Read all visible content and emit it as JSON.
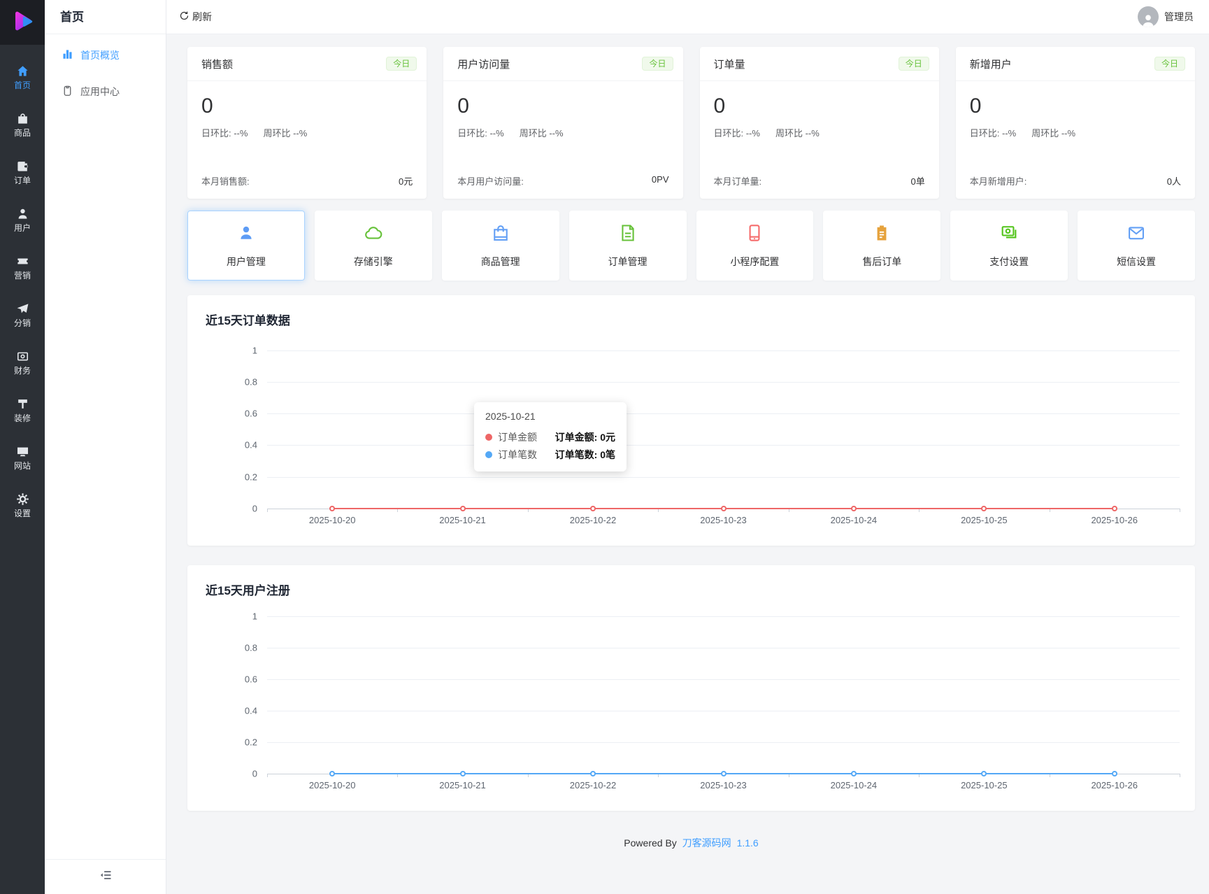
{
  "colors": {
    "accent": "#409eff",
    "badge_green": "#67c23a",
    "badge_green_bg": "#f0f9eb",
    "chart_red": "#ee6666",
    "chart_blue": "#54a8f6",
    "warning_orange": "#e6a23c",
    "danger_red": "#f56c6c",
    "success_green": "#67c23a",
    "rail_bg": "#2c3036"
  },
  "rail": {
    "logo_icon": "play-logo-icon",
    "items": [
      {
        "label": "首页",
        "icon": "home-icon",
        "active": true
      },
      {
        "label": "商品",
        "icon": "goods-bag-icon",
        "active": false
      },
      {
        "label": "订单",
        "icon": "order-wallet-icon",
        "active": false
      },
      {
        "label": "用户",
        "icon": "user-icon",
        "active": false
      },
      {
        "label": "营销",
        "icon": "marketing-ticket-icon",
        "active": false
      },
      {
        "label": "分销",
        "icon": "distribution-plane-icon",
        "active": false
      },
      {
        "label": "财务",
        "icon": "finance-money-icon",
        "active": false
      },
      {
        "label": "装修",
        "icon": "decorate-roller-icon",
        "active": false
      },
      {
        "label": "网站",
        "icon": "website-monitor-icon",
        "active": false
      },
      {
        "label": "设置",
        "icon": "gear-icon",
        "active": false
      }
    ]
  },
  "submenu": {
    "title": "首页",
    "items": [
      {
        "label": "首页概览",
        "icon": "bar-chart-icon",
        "active": true
      },
      {
        "label": "应用中心",
        "icon": "clipboard-icon",
        "active": false
      }
    ],
    "collapse_icon": "menu-fold-icon"
  },
  "topbar": {
    "refresh_label": "刷新",
    "refresh_icon": "refresh-icon",
    "user_label": "管理员",
    "avatar_icon": "person-silhouette-icon"
  },
  "stats": {
    "badge": "今日",
    "cards": [
      {
        "title": "销售额",
        "value": "0",
        "day": "日环比: --%",
        "week": "周环比 --%",
        "month_label": "本月销售额:",
        "month_value": "0元"
      },
      {
        "title": "用户访问量",
        "value": "0",
        "day": "日环比: --%",
        "week": "周环比 --%",
        "month_label": "本月用户访问量:",
        "month_value": "0PV"
      },
      {
        "title": "订单量",
        "value": "0",
        "day": "日环比: --%",
        "week": "周环比 --%",
        "month_label": "本月订单量:",
        "month_value": "0单"
      },
      {
        "title": "新增用户",
        "value": "0",
        "day": "日环比: --%",
        "week": "周环比 --%",
        "month_label": "本月新增用户:",
        "month_value": "0人"
      }
    ]
  },
  "shortcuts": [
    {
      "label": "用户管理",
      "icon": "user-icon",
      "color": "#5d9cf5",
      "highlighted": true
    },
    {
      "label": "存储引擎",
      "icon": "cloud-icon",
      "color": "#67c23a",
      "highlighted": false
    },
    {
      "label": "商品管理",
      "icon": "shopping-bag-icon",
      "color": "#64a0f5",
      "highlighted": false
    },
    {
      "label": "订单管理",
      "icon": "document-icon",
      "color": "#67c23a",
      "highlighted": false
    },
    {
      "label": "小程序配置",
      "icon": "phone-icon",
      "color": "#f56c6c",
      "highlighted": false
    },
    {
      "label": "售后订单",
      "icon": "clipboard-filled-icon",
      "color": "#e6a23c",
      "highlighted": false
    },
    {
      "label": "支付设置",
      "icon": "banknote-icon",
      "color": "#52c41a",
      "highlighted": false
    },
    {
      "label": "短信设置",
      "icon": "envelope-icon",
      "color": "#64a0f5",
      "highlighted": false
    }
  ],
  "chart_data": [
    {
      "type": "line",
      "title": "近15天订单数据",
      "x": [
        "2025-10-20",
        "2025-10-21",
        "2025-10-22",
        "2025-10-23",
        "2025-10-24",
        "2025-10-25",
        "2025-10-26"
      ],
      "series": [
        {
          "name": "订单金额",
          "values": [
            0,
            0,
            0,
            0,
            0,
            0,
            0
          ],
          "unit": "元",
          "color": "#ee6666"
        },
        {
          "name": "订单笔数",
          "values": [
            0,
            0,
            0,
            0,
            0,
            0,
            0
          ],
          "unit": "笔",
          "color": "#54a8f6"
        }
      ],
      "yticks": [
        "1",
        "0.8",
        "0.6",
        "0.4",
        "0.2",
        "0"
      ],
      "ylim": [
        0,
        1
      ],
      "grid": true,
      "legend_position": "none"
    },
    {
      "type": "line",
      "title": "近15天用户注册",
      "x": [
        "2025-10-20",
        "2025-10-21",
        "2025-10-22",
        "2025-10-23",
        "2025-10-24",
        "2025-10-25",
        "2025-10-26"
      ],
      "series": [
        {
          "values": [
            0,
            0,
            0,
            0,
            0,
            0,
            0
          ],
          "color": "#54a8f6"
        }
      ],
      "yticks": [
        "1",
        "0.8",
        "0.6",
        "0.4",
        "0.2",
        "0"
      ],
      "ylim": [
        0,
        1
      ],
      "grid": true,
      "legend_position": "none"
    }
  ],
  "tooltip": {
    "date": "2025-10-21",
    "rows": [
      {
        "name": "订单金额",
        "value": "订单金额: 0元",
        "color": "#ee6666"
      },
      {
        "name": "订单笔数",
        "value": "订单笔数: 0笔",
        "color": "#54a8f6"
      }
    ]
  },
  "footer": {
    "powered_by": "Powered By",
    "brand": "刀客源码网",
    "version": "1.1.6"
  }
}
